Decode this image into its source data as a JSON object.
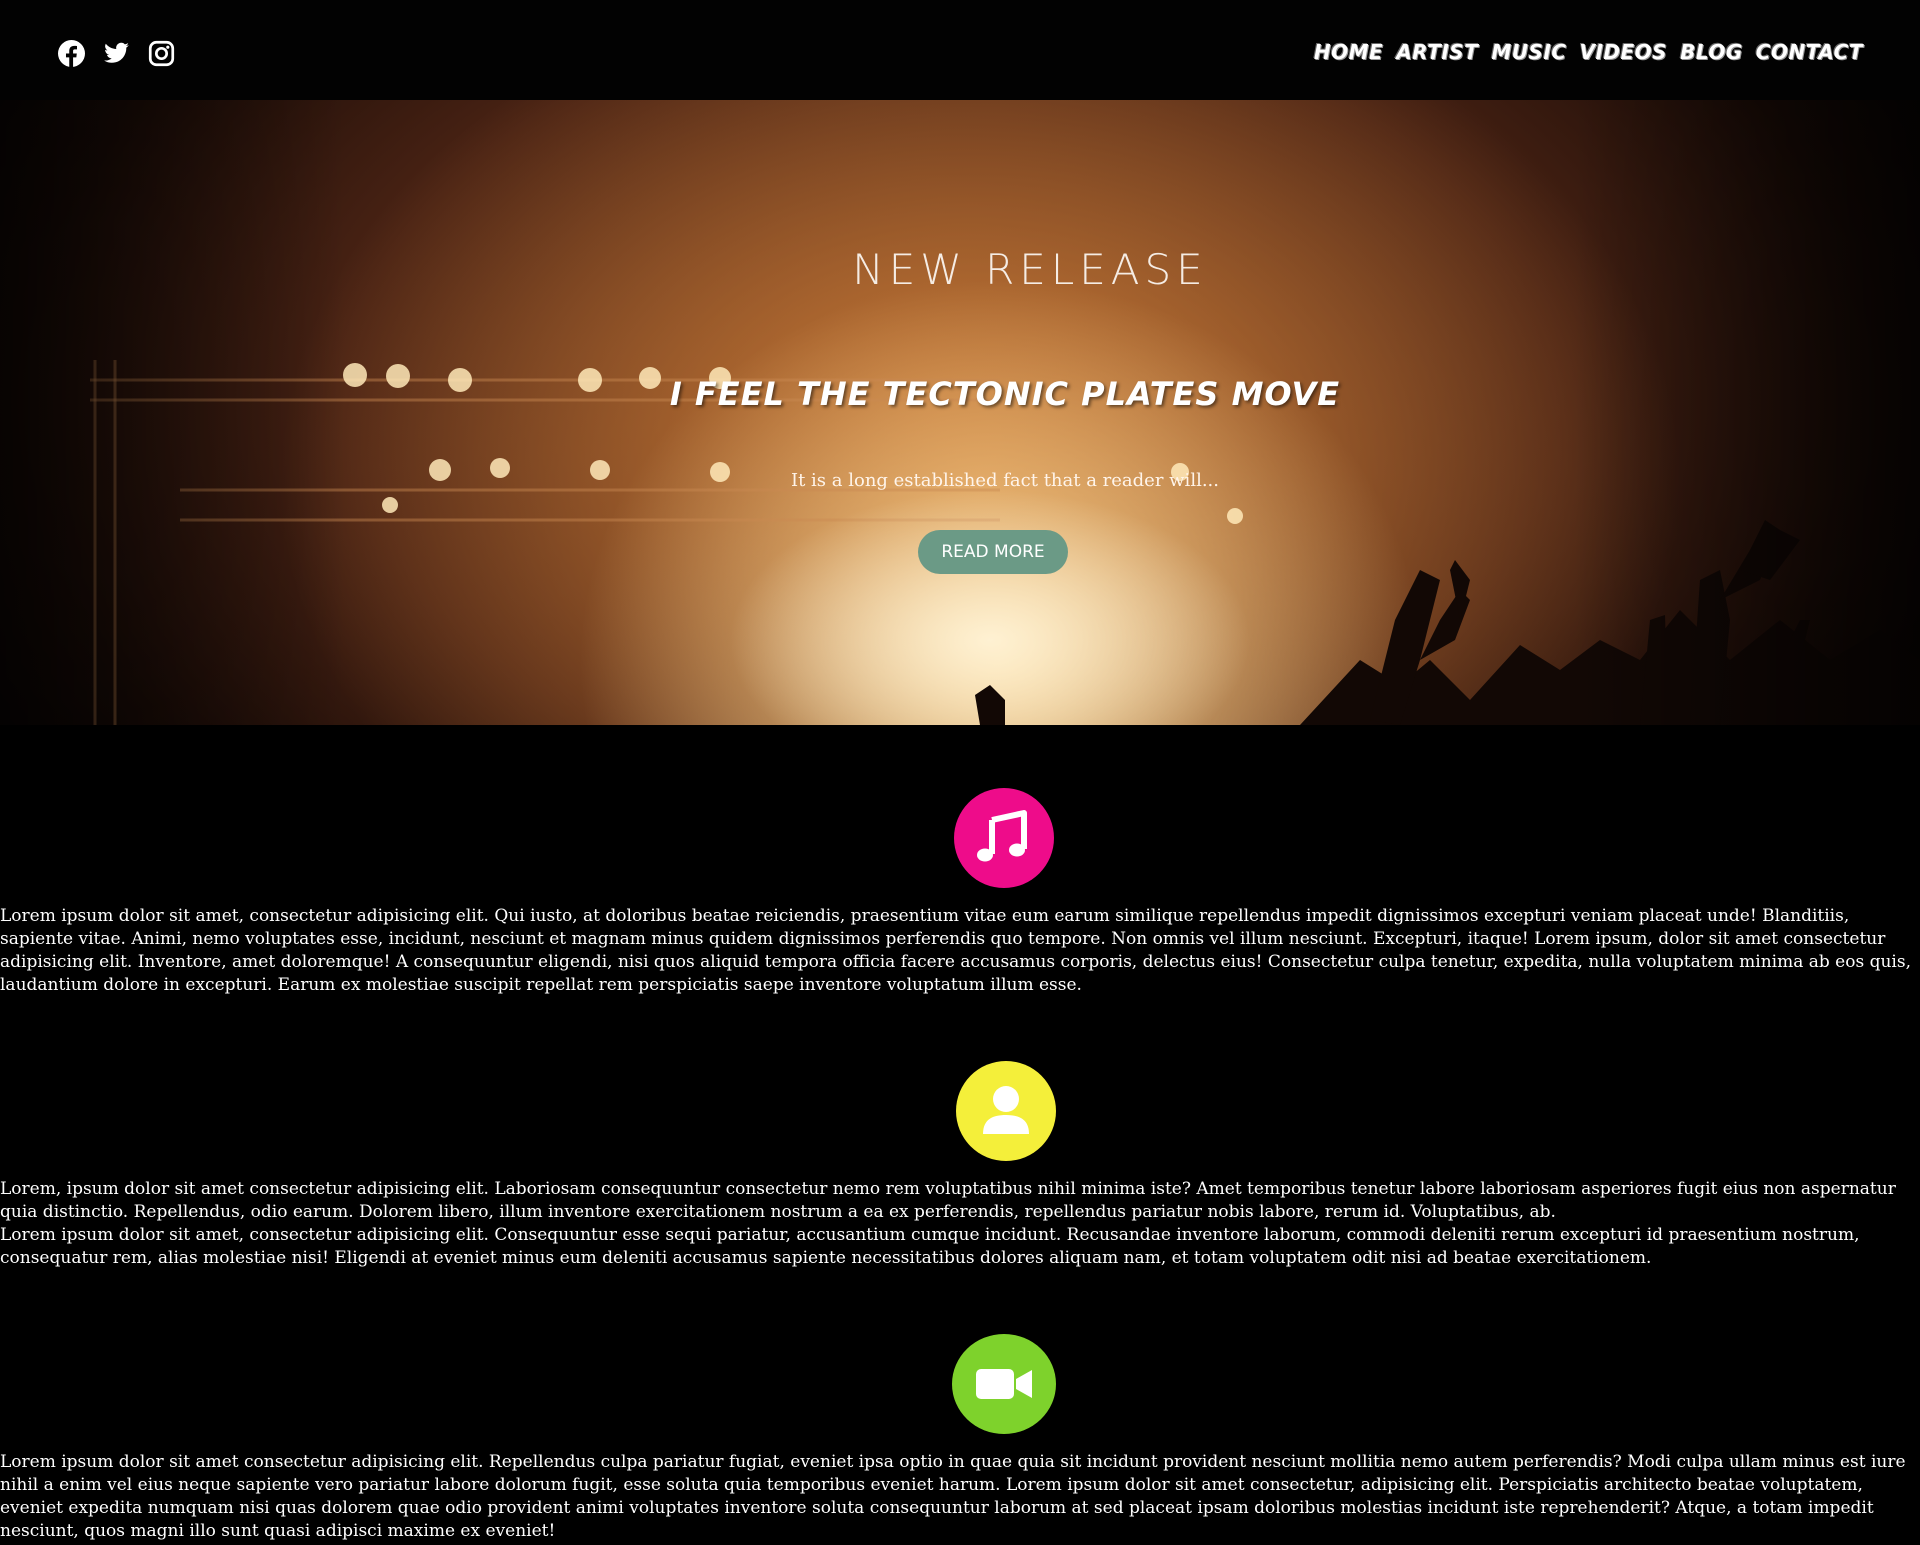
{
  "header": {
    "socials": [
      {
        "name": "facebook-icon"
      },
      {
        "name": "twitter-icon"
      },
      {
        "name": "instagram-icon"
      }
    ],
    "nav": [
      "HOME",
      "ARTIST",
      "MUSIC",
      "VIDEOS",
      "BLOG",
      "CONTACT"
    ]
  },
  "hero": {
    "kicker": "NEW RELEASE",
    "title": "I FEEL THE TECTONIC PLATES MOVE",
    "text": "It is a long established fact that a reader will...",
    "button": "READ MORE"
  },
  "features": [
    {
      "icon": "music-note-icon",
      "color": "#ee0c8a",
      "paragraphs": [
        "Lorem ipsum dolor sit amet, consectetur adipisicing elit. Qui iusto, at doloribus beatae reiciendis, praesentium vitae eum earum similique repellendus impedit dignissimos excepturi veniam placeat unde! Blanditiis, sapiente vitae. Animi, nemo voluptates esse, incidunt, nesciunt et magnam minus quidem dignissimos perferendis quo tempore. Non omnis vel illum nesciunt. Excepturi, itaque! Lorem ipsum, dolor sit amet consectetur adipisicing elit. Inventore, amet doloremque! A consequuntur eligendi, nisi quos aliquid tempora officia facere accusamus corporis, delectus eius! Consectetur culpa tenetur, expedita, nulla voluptatem minima ab eos quis, laudantium dolore in excepturi. Earum ex molestiae suscipit repellat rem perspiciatis saepe inventore voluptatum illum esse."
      ]
    },
    {
      "icon": "user-icon",
      "color": "#f4ef3a",
      "paragraphs": [
        "Lorem, ipsum dolor sit amet consectetur adipisicing elit. Laboriosam consequuntur consectetur nemo rem voluptatibus nihil minima iste? Amet temporibus tenetur labore laboriosam asperiores fugit eius non aspernatur quia distinctio. Repellendus, odio earum. Dolorem libero, illum inventore exercitationem nostrum a ea ex perferendis, repellendus pariatur nobis labore, rerum id. Voluptatibus, ab.",
        "Lorem ipsum dolor sit amet, consectetur adipisicing elit. Consequuntur esse sequi pariatur, accusantium cumque incidunt. Recusandae inventore laborum, commodi deleniti rerum excepturi id praesentium nostrum, consequatur rem, alias molestiae nisi! Eligendi at eveniet minus eum deleniti accusamus sapiente necessitatibus dolores aliquam nam, et totam voluptatem odit nisi ad beatae exercitationem."
      ]
    },
    {
      "icon": "video-camera-icon",
      "color": "#7ed22c",
      "paragraphs": [
        "Lorem ipsum dolor sit amet consectetur adipisicing elit. Repellendus culpa pariatur fugiat, eveniet ipsa optio in quae quia sit incidunt provident nesciunt mollitia nemo autem perferendis? Modi culpa ullam minus est iure nihil a enim vel eius neque sapiente vero pariatur labore dolorum fugit, esse soluta quia temporibus eveniet harum. Lorem ipsum dolor sit amet consectetur, adipisicing elit. Perspiciatis architecto beatae voluptatem, eveniet expedita numquam nisi quas dolorem quae odio provident animi voluptates inventore soluta consequuntur laborum at sed placeat ipsam doloribus molestias incidunt iste reprehenderit? Atque, a totam impedit nesciunt, quos magni illo sunt quasi adipisci maxime ex eveniet!"
      ]
    }
  ]
}
